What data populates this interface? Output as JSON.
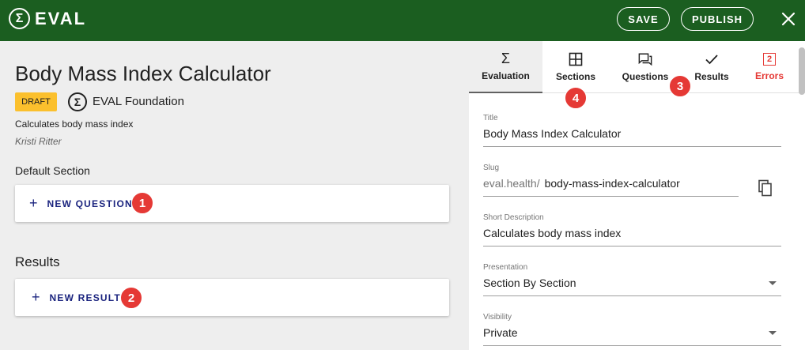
{
  "app": {
    "logo_text": "EVAL",
    "logo_glyph": "Σ"
  },
  "toolbar": {
    "save_label": "SAVE",
    "publish_label": "PUBLISH",
    "close_icon": "close-icon"
  },
  "evaluation": {
    "title": "Body Mass Index Calculator",
    "status_badge": "DRAFT",
    "org_glyph": "Σ",
    "org_name": "EVAL Foundation",
    "description": "Calculates body mass index",
    "author": "Kristi Ritter"
  },
  "sections": [
    {
      "label": "Default Section",
      "add_label": "NEW QUESTION",
      "marker": "1"
    }
  ],
  "results": {
    "label": "Results",
    "add_label": "NEW RESULT",
    "marker": "2"
  },
  "tabs": [
    {
      "label": "Evaluation",
      "icon": "sigma-icon",
      "active": true
    },
    {
      "label": "Sections",
      "icon": "grid-icon",
      "marker": "4"
    },
    {
      "label": "Questions",
      "icon": "chat-icon",
      "marker": "3"
    },
    {
      "label": "Results",
      "icon": "check-icon"
    },
    {
      "label": "Errors",
      "icon": "error-count-icon",
      "count": "2"
    }
  ],
  "form": {
    "title": {
      "label": "Title",
      "value": "Body Mass Index Calculator"
    },
    "slug": {
      "label": "Slug",
      "prefix": "eval.health/",
      "value": "body-mass-index-calculator"
    },
    "short_description": {
      "label": "Short Description",
      "value": "Calculates body mass index"
    },
    "presentation": {
      "label": "Presentation",
      "value": "Section By Section"
    },
    "visibility": {
      "label": "Visibility",
      "value": "Private"
    }
  },
  "colors": {
    "header": "#1b5e20",
    "draft": "#fbc02d",
    "marker": "#e53935",
    "link": "#1a237e",
    "error": "#e53935"
  }
}
